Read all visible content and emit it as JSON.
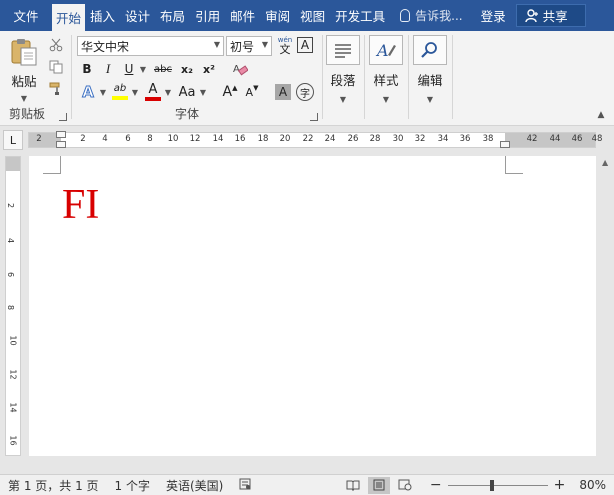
{
  "tabs": [
    {
      "label": "文件",
      "active": false
    },
    {
      "label": "开始",
      "active": true
    },
    {
      "label": "插入",
      "active": false
    },
    {
      "label": "设计",
      "active": false
    },
    {
      "label": "布局",
      "active": false
    },
    {
      "label": "引用",
      "active": false
    },
    {
      "label": "邮件",
      "active": false
    },
    {
      "label": "审阅",
      "active": false
    },
    {
      "label": "视图",
      "active": false
    },
    {
      "label": "开发工具",
      "active": false
    }
  ],
  "tell_me": "告诉我...",
  "login": "登录",
  "share": "共享",
  "clipboard": {
    "paste_label": "粘贴",
    "group_label": "剪贴板"
  },
  "font": {
    "font_name": "华文中宋",
    "font_size": "初号",
    "pinyin_glyph": "wén",
    "pinyin_sub": "文",
    "border_char": "A",
    "bold": "B",
    "italic": "I",
    "underline": "U",
    "strike": "abc",
    "subscript": "x₂",
    "superscript": "x²",
    "text_effect": "A",
    "highlight": "ab",
    "font_color": "A",
    "change_case": "Aa",
    "grow": "A",
    "shrink": "A",
    "shading": "A",
    "enclose": "字",
    "group_label": "字体"
  },
  "paragraph": {
    "label": "段落"
  },
  "styles": {
    "label": "样式"
  },
  "editing": {
    "label": "编辑"
  },
  "ruler": {
    "tab_selector": "L",
    "numbers": [
      "2",
      "2",
      "4",
      "6",
      "8",
      "10",
      "12",
      "14",
      "16",
      "18",
      "20",
      "22",
      "24",
      "26",
      "28",
      "30",
      "32",
      "34",
      "36",
      "38",
      "42",
      "44",
      "46",
      "48"
    ],
    "vertical_numbers": [
      "2",
      "4",
      "6",
      "8",
      "10",
      "12",
      "14",
      "16"
    ]
  },
  "document": {
    "text": "FI"
  },
  "status": {
    "page": "第 1 页，共 1 页",
    "words": "1 个字",
    "language": "英语(美国)",
    "zoom": "80%",
    "zoom_minus": "−",
    "zoom_plus": "+"
  },
  "colors": {
    "accent": "#2b579a",
    "doc_text": "#d80000",
    "highlight": "#ffff00",
    "font_color_bar": "#d80000"
  }
}
